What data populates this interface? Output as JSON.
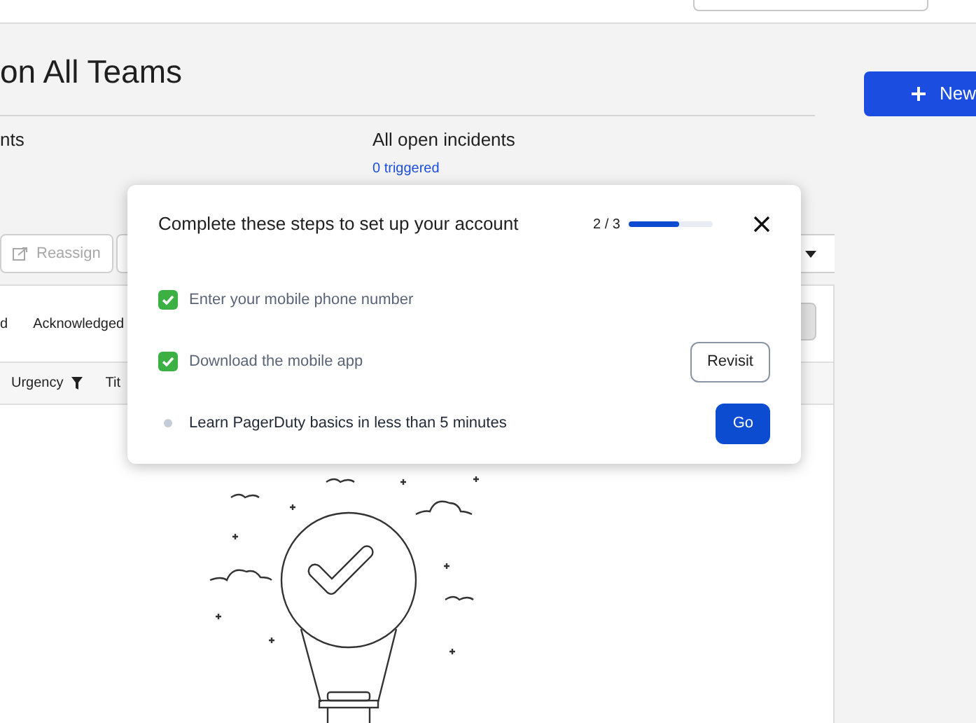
{
  "page_title": "on All Teams",
  "new_button": "New",
  "summary": [
    {
      "label": "nts"
    },
    {
      "label": "All open incidents",
      "links": [
        "0 triggered"
      ]
    }
  ],
  "toolbar": {
    "buttons": [
      {
        "label": "Reassign",
        "disabled": true
      }
    ]
  },
  "tabs": [
    "d",
    "Acknowledged"
  ],
  "columns": [
    {
      "label": "Urgency",
      "filter": true
    },
    {
      "label": "Tit"
    }
  ],
  "setup_modal": {
    "title": "Complete these steps to set up your account",
    "progress_text": "2 / 3",
    "level": 0.6,
    "steps": [
      {
        "label": "Enter your mobile phone number",
        "done": true
      },
      {
        "label": "Download the mobile app",
        "done": true,
        "button": {
          "label": "Revisit",
          "kind": "outline"
        }
      },
      {
        "label": "Learn PagerDuty basics in less than 5 minutes",
        "done": false,
        "button": {
          "label": "Go",
          "kind": "primary"
        }
      }
    ]
  }
}
